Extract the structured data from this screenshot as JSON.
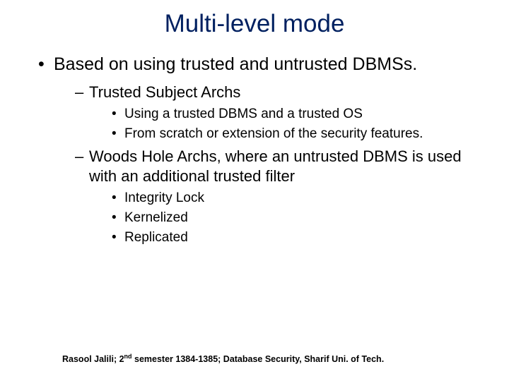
{
  "title": "Multi-level mode",
  "bullets": {
    "main": "Based on using trusted and untrusted DBMSs.",
    "sub1": {
      "heading": "Trusted Subject Archs",
      "items": [
        "Using a trusted DBMS and a trusted OS",
        "From scratch or extension of the security features."
      ]
    },
    "sub2": {
      "heading": "Woods Hole Archs, where an untrusted DBMS is used with an additional trusted filter",
      "items": [
        "Integrity Lock",
        "Kernelized",
        "Replicated"
      ]
    }
  },
  "footer": {
    "prefix": "Rasool Jalili; 2",
    "super": "nd",
    "suffix": " semester 1384-1385; Database Security, Sharif Uni. of Tech."
  }
}
